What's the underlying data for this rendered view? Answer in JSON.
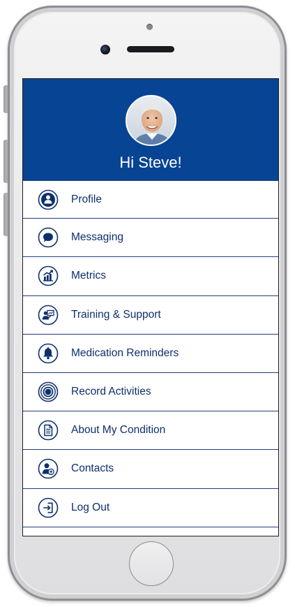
{
  "header": {
    "greeting": "Hi Steve!"
  },
  "menu": {
    "items": [
      {
        "label": "Profile",
        "icon": "person-icon"
      },
      {
        "label": "Messaging",
        "icon": "chat-bubble-icon"
      },
      {
        "label": "Metrics",
        "icon": "chart-trend-icon"
      },
      {
        "label": "Training & Support",
        "icon": "presentation-icon"
      },
      {
        "label": "Medication Reminders",
        "icon": "bell-icon"
      },
      {
        "label": "Record Activities",
        "icon": "record-icon"
      },
      {
        "label": "About My Condition",
        "icon": "document-icon"
      },
      {
        "label": "Contacts",
        "icon": "contact-add-icon"
      },
      {
        "label": "Log Out",
        "icon": "logout-icon"
      }
    ]
  },
  "colors": {
    "brand_blue": "#074494",
    "text_navy": "#0d2f6c",
    "divider": "#1e3f79"
  }
}
